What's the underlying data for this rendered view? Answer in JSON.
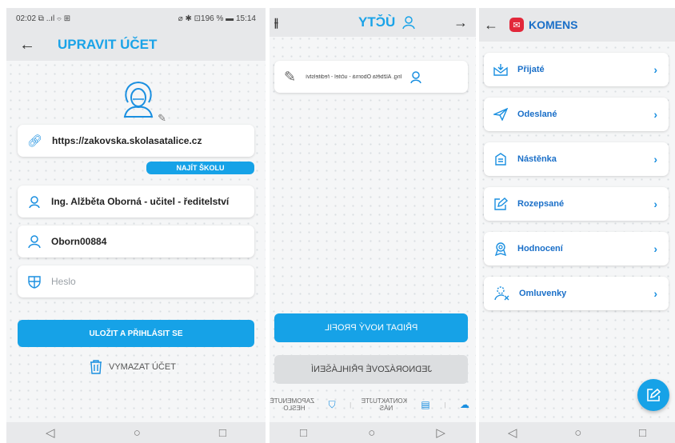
{
  "screen1": {
    "status": {
      "left": "02:02 ⧉ ..ıl ⌔ ⊞",
      "right": "⌀ ✱ ⊡196 % ▬ 15:14"
    },
    "title": "UPRAVIT ÚČET",
    "school_url": "https://zakovska.skolasatalice.cz",
    "find_school": "NAJÍT ŠKOLU",
    "user_name": "Ing. Alžběta Oborná - učitel - ředitelství",
    "username": "Oborn00884",
    "password_placeholder": "Heslo",
    "save_login": "ULOŽIT A PŘIHLÁSIT SE",
    "delete_account": "VYMAZAT ÚČET",
    "nav": [
      "◁",
      "○",
      "□"
    ]
  },
  "screen2": {
    "title": "ÚČTY",
    "profile_text": "Ing. Alžběta Oborná - učitel - ředitelství",
    "add_profile": "PŘIDAT NOVÝ PROFIL",
    "one_time_login": "JEDNORÁZOVÉ PŘIHLÁŠENÍ",
    "contact_us": "KONTAKTUJTE NÁS",
    "forgot_password": "ZAPOMENUTÉ HESLO",
    "nav": [
      "□",
      "○",
      "▷"
    ]
  },
  "screen3": {
    "title": "KOMENS",
    "menu": [
      "Přijaté",
      "Odeslané",
      "Nástěnka",
      "Rozepsané",
      "Hodnocení",
      "Omluvenky"
    ],
    "nav": [
      "◁",
      "○",
      "□"
    ]
  },
  "colors": {
    "accent": "#16a2e7",
    "title": "#1aa3e8",
    "menu_text": "#1a6fc8",
    "brand_red": "#e2273a"
  }
}
